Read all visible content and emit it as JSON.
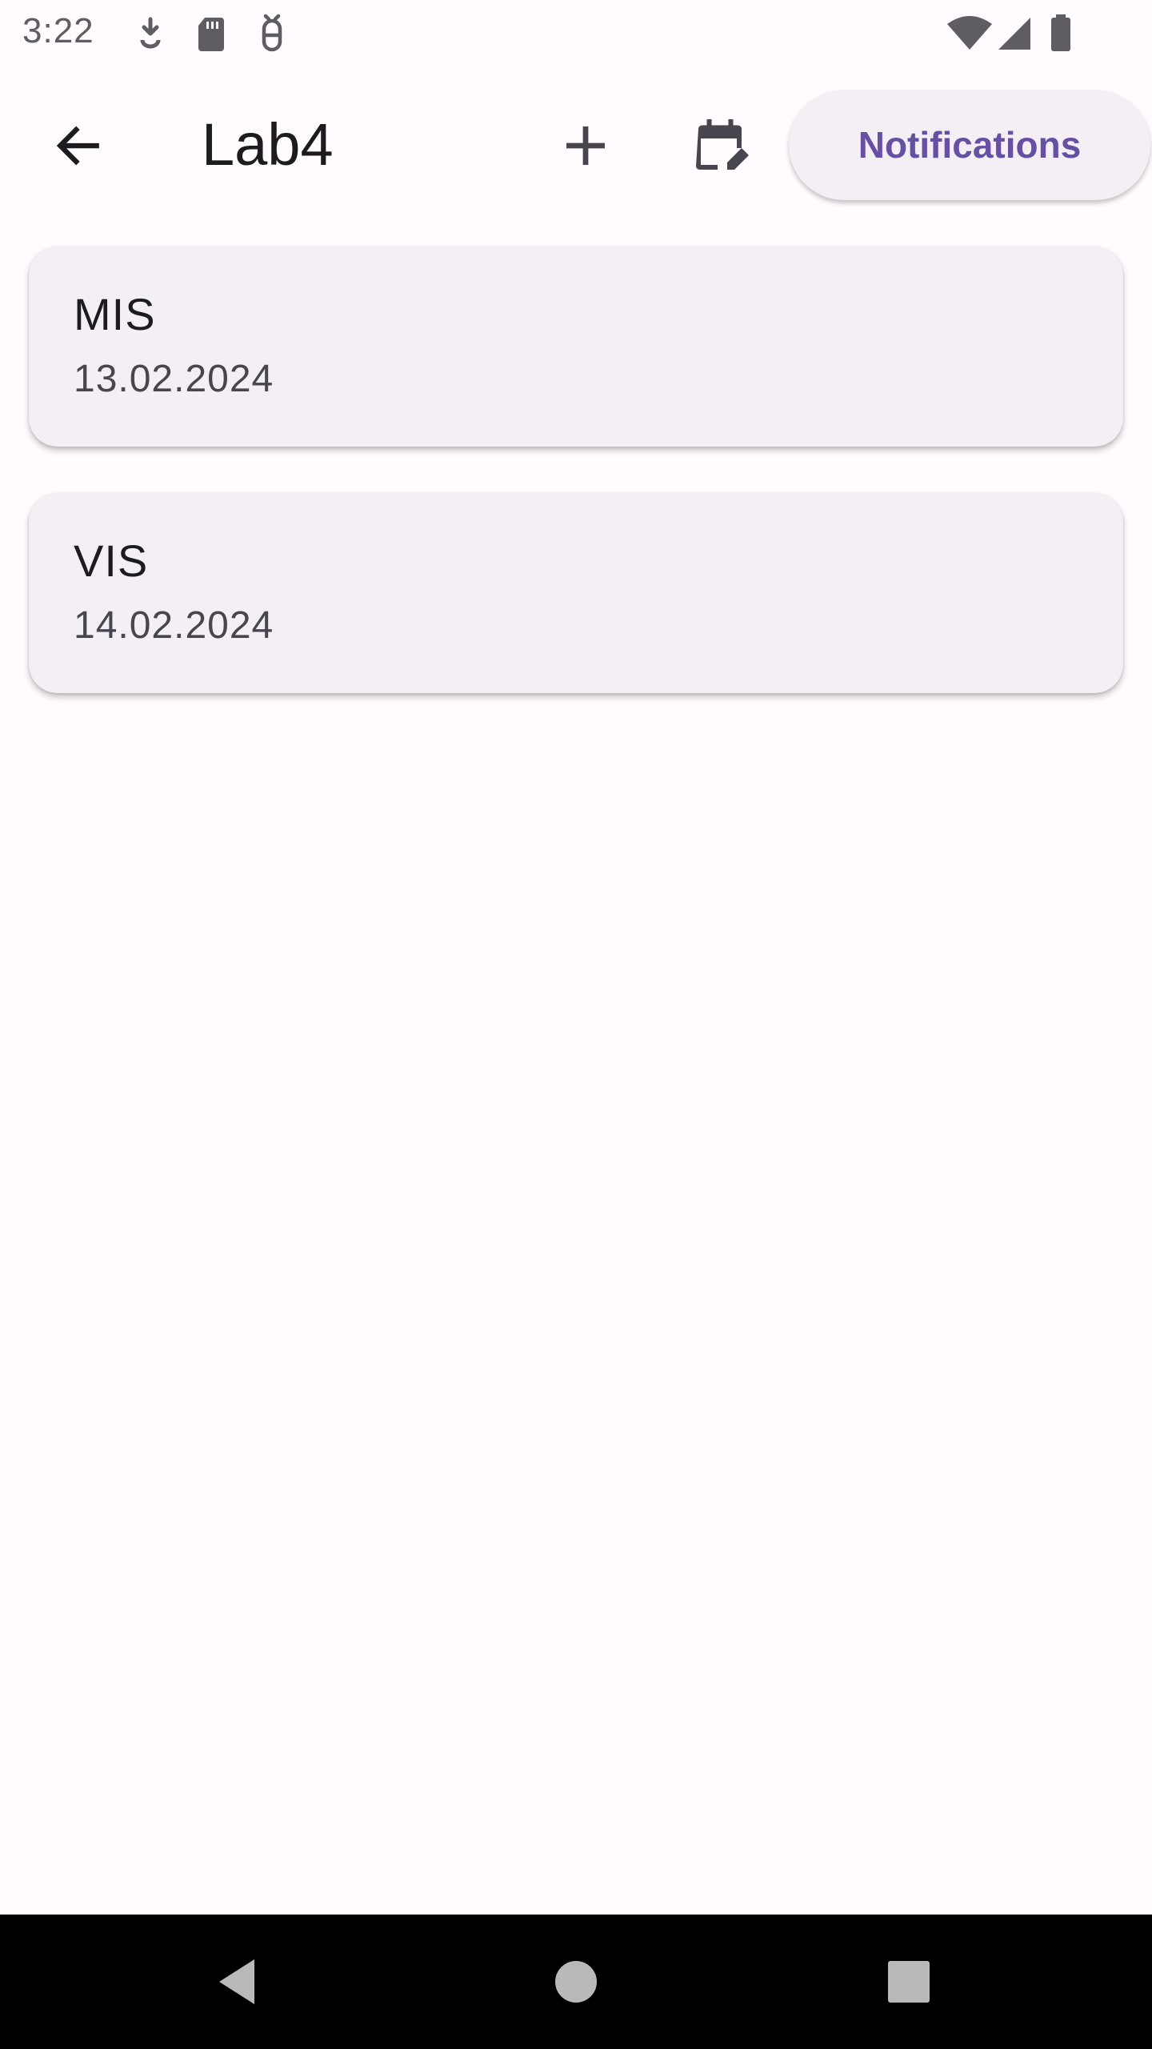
{
  "status_bar": {
    "time": "3:22",
    "left_icons": [
      "download-icon",
      "sd-card-icon",
      "debug-icon"
    ],
    "right_icons": [
      "wifi-icon",
      "cellular-signal-icon",
      "battery-icon"
    ]
  },
  "app_bar": {
    "back_icon": "arrow-back-icon",
    "title": "Lab4",
    "add_icon": "add-icon",
    "calendar_icon": "edit-calendar-icon",
    "notifications_label": "Notifications"
  },
  "items": [
    {
      "title": "MIS",
      "date": "13.02.2024"
    },
    {
      "title": "VIS",
      "date": "14.02.2024"
    }
  ],
  "nav_bar": {
    "back_icon": "nav-back-icon",
    "home_icon": "nav-home-icon",
    "recents_icon": "nav-recents-icon"
  },
  "colors": {
    "background": "#fffbfe",
    "card": "#f3eff4",
    "accent": "#6750a4",
    "text": "#1c1b1f",
    "subtext": "#49454f"
  }
}
